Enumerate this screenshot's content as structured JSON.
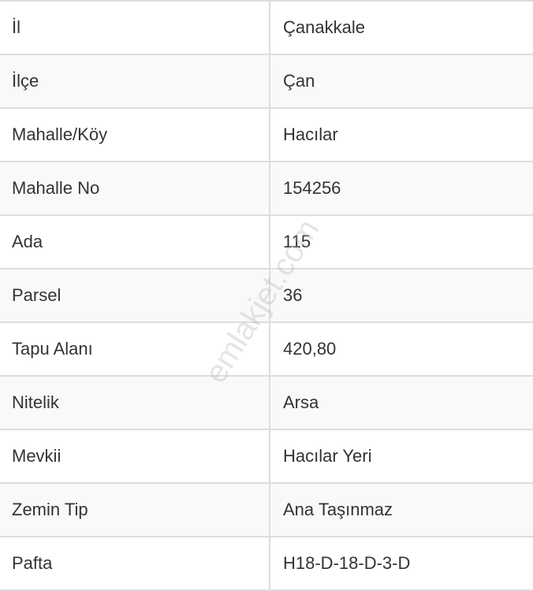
{
  "table": {
    "rows": [
      {
        "label": "İl",
        "value": "Çanakkale"
      },
      {
        "label": "İlçe",
        "value": "Çan"
      },
      {
        "label": "Mahalle/Köy",
        "value": "Hacılar"
      },
      {
        "label": "Mahalle No",
        "value": "154256"
      },
      {
        "label": "Ada",
        "value": "115"
      },
      {
        "label": "Parsel",
        "value": "36"
      },
      {
        "label": "Tapu Alanı",
        "value": "420,80"
      },
      {
        "label": "Nitelik",
        "value": "Arsa"
      },
      {
        "label": "Mevkii",
        "value": "Hacılar Yeri"
      },
      {
        "label": "Zemin Tip",
        "value": "Ana Taşınmaz"
      },
      {
        "label": "Pafta",
        "value": "H18-D-18-D-3-D"
      }
    ]
  },
  "watermark": "emlakjet.com"
}
